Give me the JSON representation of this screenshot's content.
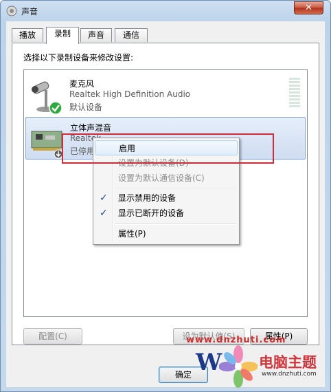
{
  "window": {
    "title": "声音",
    "close_label": "✕"
  },
  "tabs": [
    {
      "label": "播放"
    },
    {
      "label": "录制"
    },
    {
      "label": "声音"
    },
    {
      "label": "通信"
    }
  ],
  "instruction": "选择以下录制设备来修改设置:",
  "devices": [
    {
      "name": "麦克风",
      "driver": "Realtek High Definition Audio",
      "status": "默认设备",
      "icon": "microphone-icon",
      "badge": "default-check"
    },
    {
      "name": "立体声混音",
      "driver": "Realtek",
      "status": "已停用",
      "icon": "sound-card-icon",
      "badge": "disabled-arrow"
    }
  ],
  "context_menu": {
    "items": [
      {
        "label": "启用",
        "state": "hover"
      },
      {
        "label": "设置为默认设备(D)",
        "state": "disabled"
      },
      {
        "label": "设置为默认通信设备(C)",
        "state": "disabled"
      },
      {
        "label": "显示禁用的设备",
        "checked": true
      },
      {
        "label": "显示已断开的设备",
        "checked": true
      },
      {
        "label": "属性(P)"
      }
    ]
  },
  "buttons": {
    "configure": "配置(C)",
    "set_default": "设为默认值(S)",
    "properties": "属性(P)",
    "ok": "确定"
  },
  "watermark": {
    "text1": "www.dnzhuti.com",
    "logo_letter": "W",
    "brand": "电脑主题",
    "url": "www.dnzhuti.com"
  },
  "colors": {
    "highlight_box": "#d12b3b",
    "check": "#1d4f91",
    "ok_check_badge": "#2eaa3c"
  }
}
